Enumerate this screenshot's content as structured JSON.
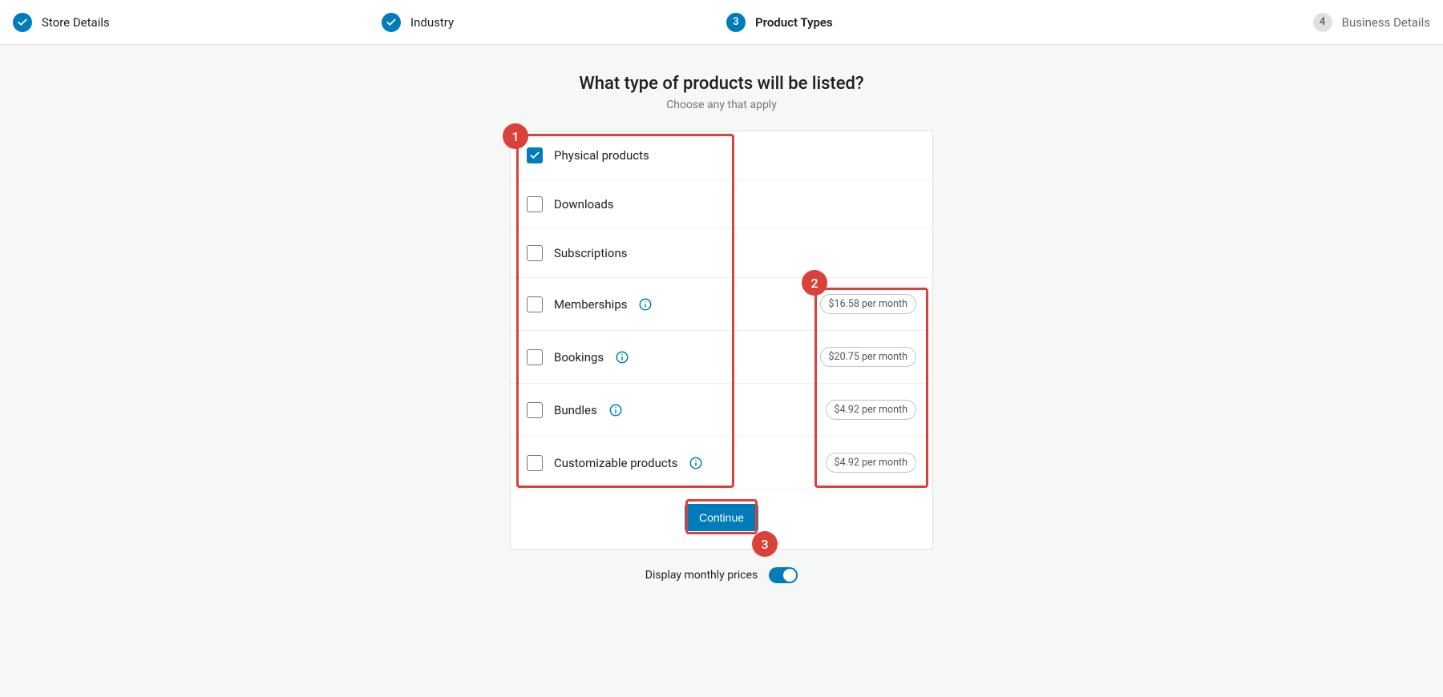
{
  "stepper": {
    "steps": [
      {
        "label": "Store Details",
        "state": "completed",
        "badge": ""
      },
      {
        "label": "Industry",
        "state": "completed",
        "badge": ""
      },
      {
        "label": "Product Types",
        "state": "current",
        "badge": "3"
      },
      {
        "label": "Business Details",
        "state": "upcoming",
        "badge": "4"
      }
    ]
  },
  "heading": "What type of products will be listed?",
  "subheading": "Choose any that apply",
  "options": [
    {
      "label": "Physical products",
      "checked": true,
      "info": false,
      "price": ""
    },
    {
      "label": "Downloads",
      "checked": false,
      "info": false,
      "price": ""
    },
    {
      "label": "Subscriptions",
      "checked": false,
      "info": false,
      "price": ""
    },
    {
      "label": "Memberships",
      "checked": false,
      "info": true,
      "price": "$16.58 per month"
    },
    {
      "label": "Bookings",
      "checked": false,
      "info": true,
      "price": "$20.75 per month"
    },
    {
      "label": "Bundles",
      "checked": false,
      "info": true,
      "price": "$4.92 per month"
    },
    {
      "label": "Customizable products",
      "checked": false,
      "info": true,
      "price": "$4.92 per month"
    }
  ],
  "continue_label": "Continue",
  "toggle_label": "Display monthly prices",
  "annotations": {
    "n1": "1",
    "n2": "2",
    "n3": "3"
  }
}
